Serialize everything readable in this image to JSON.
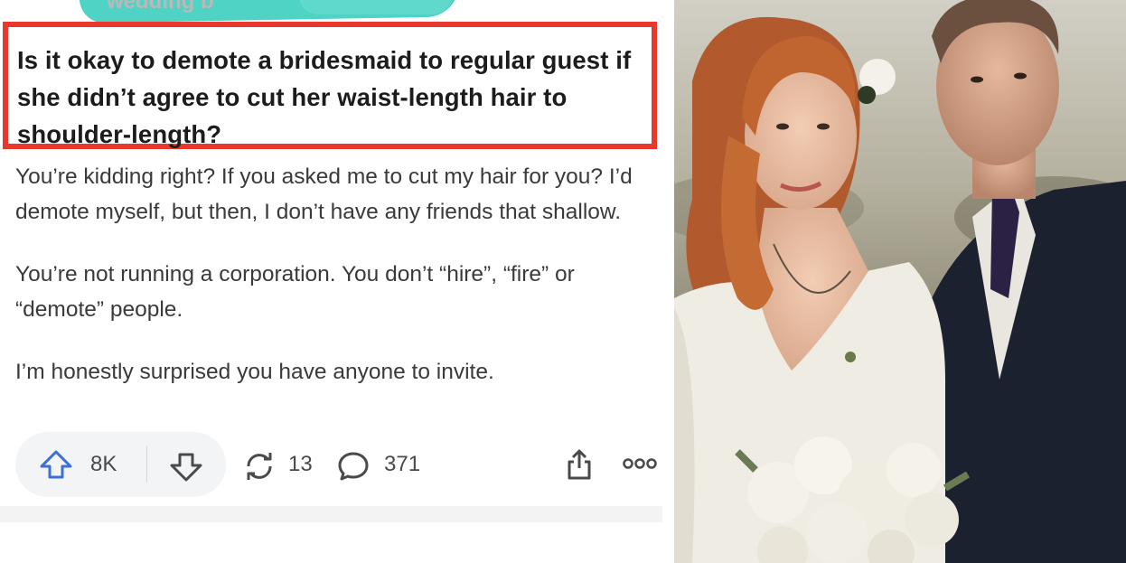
{
  "post": {
    "faded_header": "wedding b",
    "title": "Is it okay to demote a bridesmaid to regular guest if she didn’t agree to cut her waist-length hair to shoulder-length?",
    "comment": {
      "paragraphs": [
        "You’re kidding right? If you asked me to cut my hair for you? I’d demote myself, but then, I don’t have any friends that shallow.",
        "You’re not running a corporation. You don’t “hire”, “fire” or “demote” people.",
        "I’m honestly surprised you have anyone to invite."
      ]
    },
    "actions": {
      "upvotes": "8K",
      "reposts": "13",
      "comments": "371"
    }
  },
  "colors": {
    "title_border": "#e8372d",
    "upvote_accent": "#3b6fd4",
    "scribble": "#4fd3c4"
  },
  "icons": [
    "upvote-icon",
    "downvote-icon",
    "repost-icon",
    "comment-icon",
    "share-icon",
    "more-icon"
  ]
}
